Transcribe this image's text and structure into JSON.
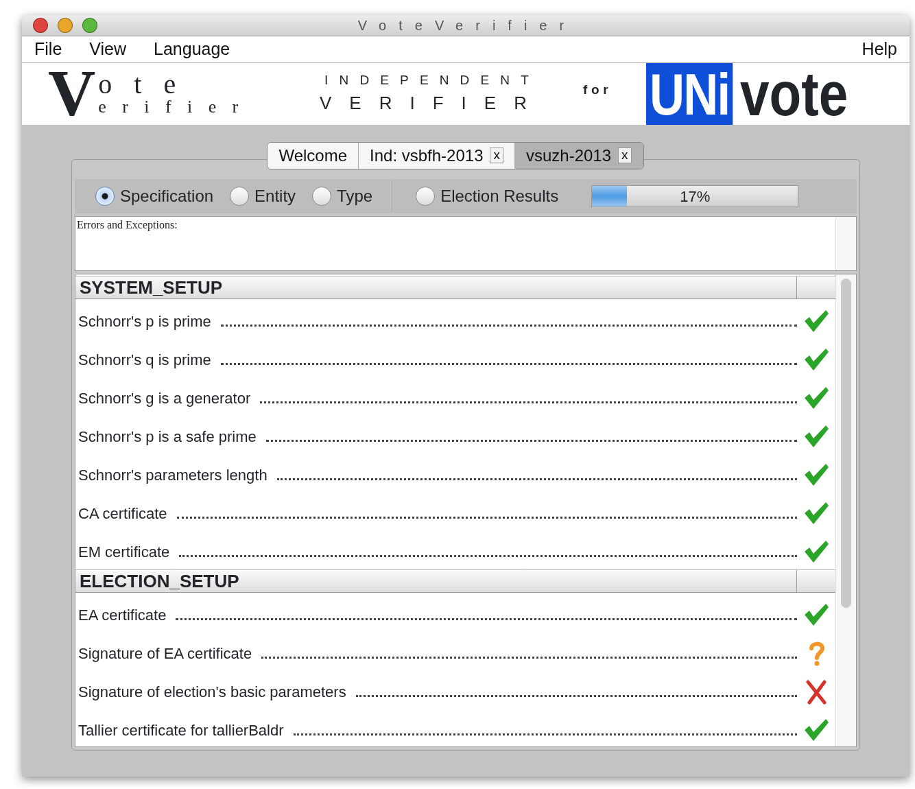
{
  "window": {
    "title": "VoteVerifier"
  },
  "menu": {
    "left": [
      "File",
      "View",
      "Language"
    ],
    "right": [
      "Help"
    ]
  },
  "banner": {
    "logo_initial": "V",
    "logo_top": "ote",
    "logo_bottom": "erifier",
    "line_1": "INDEPENDENT",
    "line_2": "VERIFIER",
    "connector": "for",
    "brand_box": "UNi",
    "brand_word": "vote"
  },
  "tabs": [
    {
      "label": "Welcome",
      "selected": false
    },
    {
      "label": "Ind: vsbfh-2013",
      "close": "x",
      "selected": false
    },
    {
      "label": "vsuzh-2013",
      "close": "x",
      "selected": true
    }
  ],
  "views": [
    {
      "label": "Specification",
      "selected": true
    },
    {
      "label": "Entity",
      "selected": false
    },
    {
      "label": "Type",
      "selected": false
    },
    {
      "label": "Election Results",
      "selected": false
    }
  ],
  "progress": {
    "level": 0.17,
    "reading": "17%"
  },
  "errors": {
    "label": "Errors and Exceptions:"
  },
  "sections": [
    {
      "title": "SYSTEM_SETUP",
      "items": [
        {
          "label": "Schnorr's p is prime",
          "kind": "ok"
        },
        {
          "label": "Schnorr's q is prime",
          "kind": "ok"
        },
        {
          "label": "Schnorr's g is a generator",
          "kind": "ok"
        },
        {
          "label": "Schnorr's p is a safe prime",
          "kind": "ok"
        },
        {
          "label": "Schnorr's parameters length",
          "kind": "ok"
        },
        {
          "label": "CA certificate",
          "kind": "ok"
        },
        {
          "label": "EM certificate",
          "kind": "ok"
        }
      ]
    },
    {
      "title": "ELECTION_SETUP",
      "items": [
        {
          "label": "EA certificate",
          "kind": "ok"
        },
        {
          "label": "Signature of EA certificate",
          "kind": "unknown"
        },
        {
          "label": "Signature of election's basic parameters",
          "kind": "fail"
        },
        {
          "label": "Tallier certificate for tallierBaldr",
          "kind": "ok"
        }
      ]
    }
  ]
}
